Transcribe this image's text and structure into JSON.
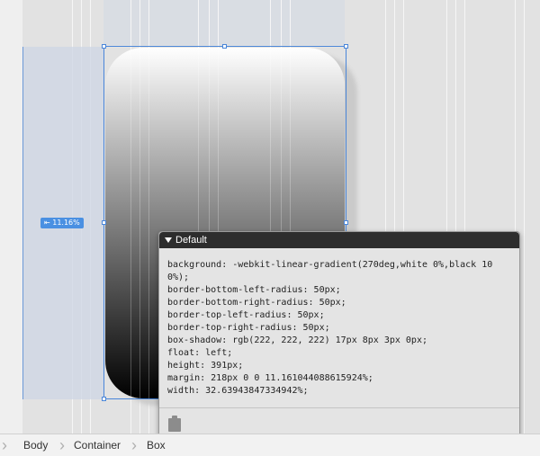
{
  "margin_indicator": {
    "label": "⇤ 11.16%"
  },
  "popup": {
    "title": "Default",
    "css_lines": [
      "background: -webkit-linear-gradient(270deg,white 0%,black 100%);",
      "border-bottom-left-radius: 50px;",
      "border-bottom-right-radius: 50px;",
      "border-top-left-radius: 50px;",
      "border-top-right-radius: 50px;",
      "box-shadow: rgb(222, 222, 222) 17px 8px 3px 0px;",
      "float: left;",
      "height: 391px;",
      "margin: 218px 0 0 11.161044088615924%;",
      "width: 32.63943847334942%;"
    ],
    "clipboard_icon": "clipboard-icon"
  },
  "breadcrumb": {
    "items": [
      "Body",
      "Container",
      "Box"
    ]
  },
  "colors": {
    "selection_blue": "#4a86d9",
    "header_dark": "#2d2d2d"
  }
}
